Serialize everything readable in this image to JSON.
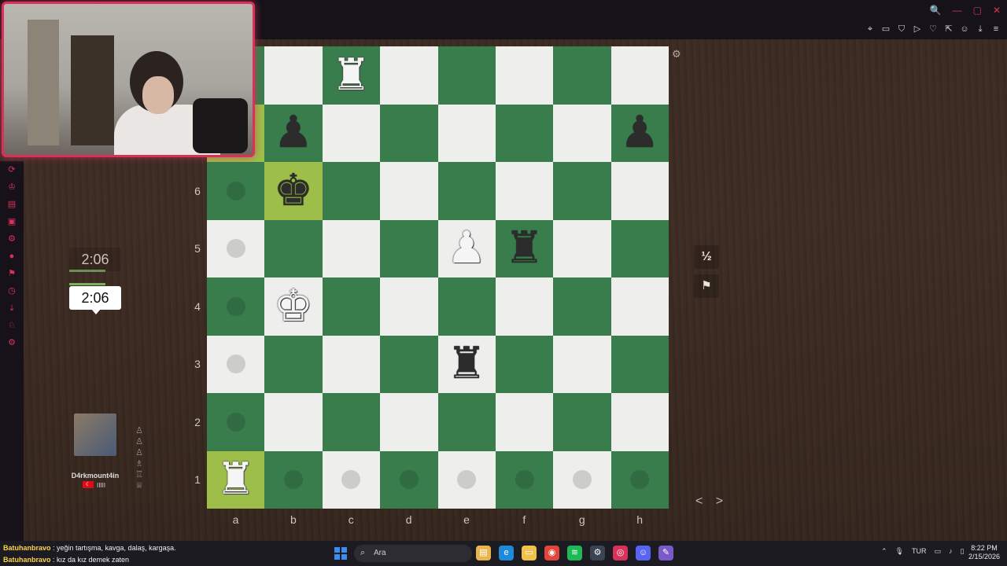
{
  "window": {
    "controls": [
      "🔍",
      "—",
      "▢",
      "✕"
    ],
    "toolbar_icons": [
      "pin-icon",
      "crop-icon",
      "shield-icon",
      "play-icon",
      "heart-icon",
      "share-icon",
      "user-icon",
      "download-icon",
      "menu-icon"
    ],
    "toolbar_glyphs": [
      "⌖",
      "▭",
      "⛉",
      "▷",
      "♡",
      "⇱",
      "☺",
      "⤓",
      "≡"
    ]
  },
  "left_strip_glyphs": [
    "⟳",
    "♔",
    "▤",
    "▣",
    "⚙",
    "●",
    "⚑",
    "◷",
    "⤓",
    "♘",
    "⚙"
  ],
  "board": {
    "highlight_squares": [
      "b6",
      "a1",
      "a7"
    ],
    "pieces": [
      {
        "square": "c8",
        "glyph": "♜",
        "color": "white",
        "name": "white-rook"
      },
      {
        "square": "b7",
        "glyph": "♟",
        "color": "black",
        "name": "black-pawn"
      },
      {
        "square": "h7",
        "glyph": "♟",
        "color": "black",
        "name": "black-pawn"
      },
      {
        "square": "b6",
        "glyph": "♚",
        "color": "black",
        "name": "black-king"
      },
      {
        "square": "e5",
        "glyph": "♟",
        "color": "white",
        "name": "white-pawn"
      },
      {
        "square": "f5",
        "glyph": "♜",
        "color": "black",
        "name": "black-rook"
      },
      {
        "square": "b4",
        "glyph": "♚",
        "color": "white",
        "name": "white-king"
      },
      {
        "square": "e3",
        "glyph": "♜",
        "color": "black",
        "name": "black-rook"
      },
      {
        "square": "a1",
        "glyph": "♜",
        "color": "white",
        "name": "white-rook"
      }
    ],
    "move_dots": [
      "a6",
      "a5",
      "a4",
      "a3",
      "a2",
      "b1",
      "c1",
      "d1",
      "e1",
      "f1",
      "g1",
      "h1"
    ],
    "ranks": [
      "6",
      "5",
      "4",
      "3",
      "2",
      "1"
    ],
    "files": [
      "a",
      "b",
      "c",
      "d",
      "e",
      "f",
      "g",
      "h"
    ]
  },
  "clocks": {
    "top": "2:06",
    "bottom": "2:06"
  },
  "opponent": {
    "username": "D4rkmount4in",
    "rating_marks": "IIIII",
    "captured": [
      "♙",
      "♙",
      "♙",
      "♗",
      "♖",
      "♕"
    ]
  },
  "controls": {
    "draw_label": "½",
    "resign_icon": "flag-icon",
    "nav": "< >"
  },
  "chat": [
    {
      "user": "Batuhanbravo",
      "message": " : yeğin tartışma, kavga, dalaş, kargaşa."
    },
    {
      "user": "Batuhanbravo",
      "message": " : kız da kız demek zaten"
    }
  ],
  "taskbar": {
    "search_placeholder": "Ara",
    "language": "TUR",
    "time": "8:22 PM",
    "date": "2/15/2026",
    "colors": {
      "accent": "#d9325a",
      "start": "#3a8ef0"
    }
  }
}
